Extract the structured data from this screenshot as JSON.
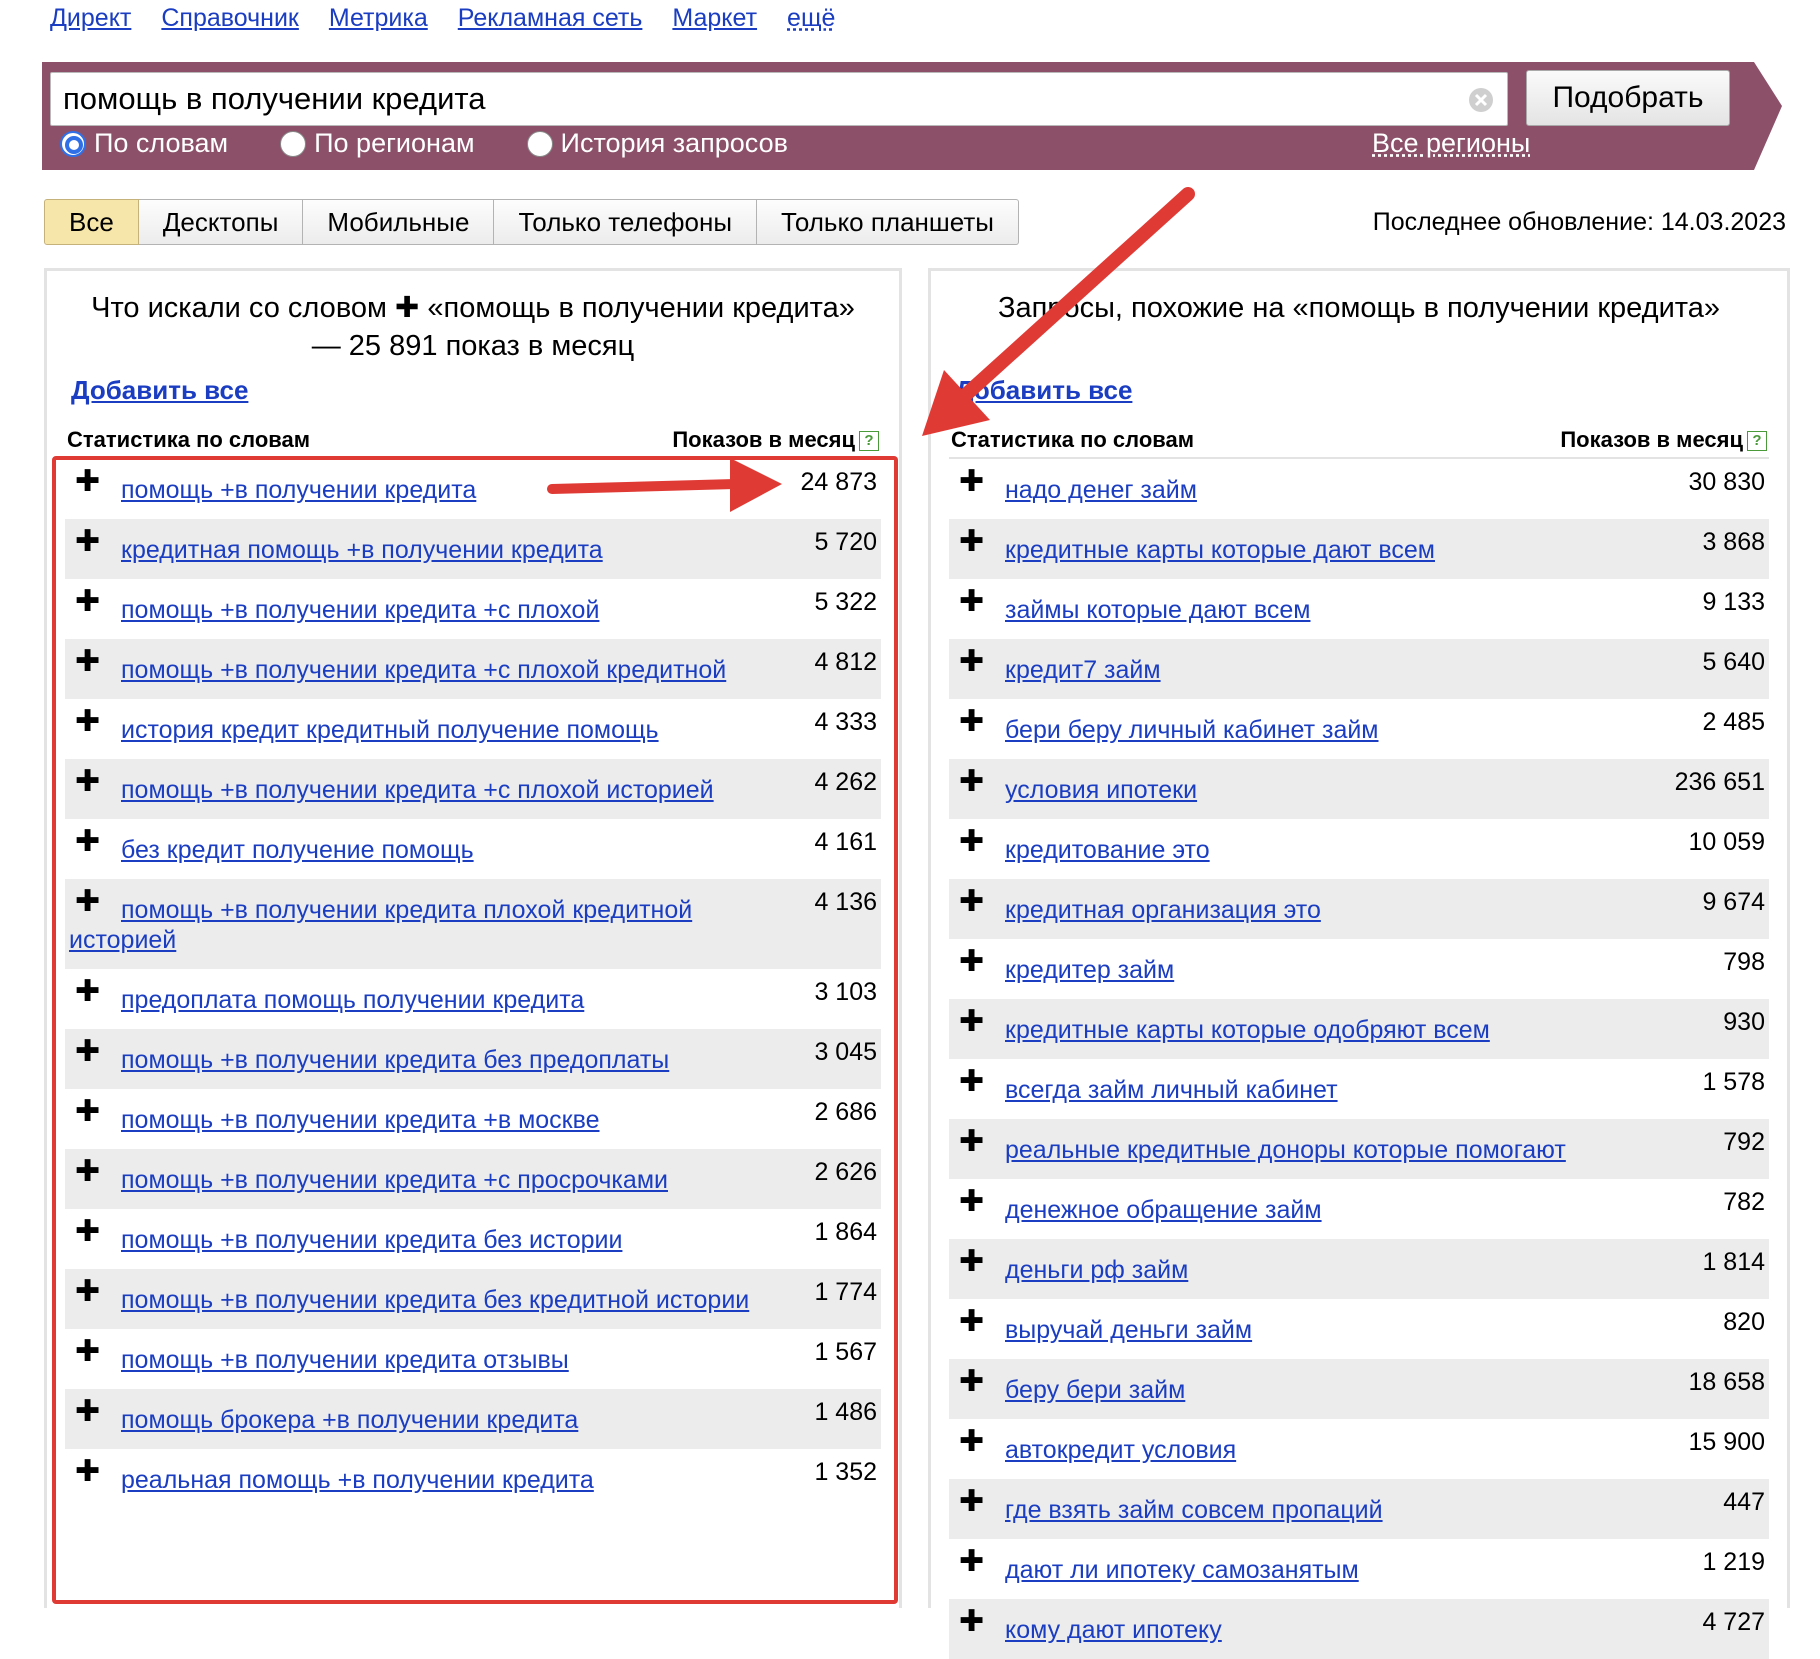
{
  "top_nav": [
    "Директ",
    "Справочник",
    "Метрика",
    "Рекламная сеть",
    "Маркет",
    "ещё"
  ],
  "search": {
    "query": "помощь в получении кредита",
    "button": "Подобрать",
    "radios": [
      "По словам",
      "По регионам",
      "История запросов"
    ],
    "selected_radio": "По словам",
    "regions": "Все регионы"
  },
  "tabs": [
    "Все",
    "Десктопы",
    "Мобильные",
    "Только телефоны",
    "Только планшеты"
  ],
  "active_tab": "Все",
  "last_update": "Последнее обновление: 14.03.2023",
  "left": {
    "title_prefix": "Что искали со словом",
    "title_rest": "«помощь в получении кредита» — 25 891 показ в месяц",
    "add_all": "Добавить все",
    "col_words": "Статистика по словам",
    "col_shows": "Показов в месяц",
    "rows": [
      {
        "phrase": "помощь +в получении кредита",
        "count": "24 873"
      },
      {
        "phrase": "кредитная помощь +в получении кредита",
        "count": "5 720"
      },
      {
        "phrase": "помощь +в получении кредита +с плохой",
        "count": "5 322"
      },
      {
        "phrase": "помощь +в получении кредита +с плохой кредитной",
        "count": "4 812"
      },
      {
        "phrase": "история кредит кредитный получение помощь",
        "count": "4 333"
      },
      {
        "phrase": "помощь +в получении кредита +с плохой историей",
        "count": "4 262"
      },
      {
        "phrase": "без кредит получение помощь",
        "count": "4 161"
      },
      {
        "phrase": "помощь +в получении кредита плохой кредитной историей",
        "count": "4 136"
      },
      {
        "phrase": "предоплата помощь получении кредита",
        "count": "3 103"
      },
      {
        "phrase": "помощь +в получении кредита без предоплаты",
        "count": "3 045"
      },
      {
        "phrase": "помощь +в получении кредита +в москве",
        "count": "2 686"
      },
      {
        "phrase": "помощь +в получении кредита +с просрочками",
        "count": "2 626"
      },
      {
        "phrase": "помощь +в получении кредита без истории",
        "count": "1 864"
      },
      {
        "phrase": "помощь +в получении кредита без кредитной истории",
        "count": "1 774"
      },
      {
        "phrase": "помощь +в получении кредита отзывы",
        "count": "1 567"
      },
      {
        "phrase": "помощь брокера +в получении кредита",
        "count": "1 486"
      },
      {
        "phrase": "реальная помощь +в получении кредита",
        "count": "1 352"
      }
    ]
  },
  "right": {
    "title": "Запросы, похожие на «помощь в получении кредита»",
    "add_all": "Добавить все",
    "col_words": "Статистика по словам",
    "col_shows": "Показов в месяц",
    "rows": [
      {
        "phrase": "надо денег займ",
        "count": "30 830"
      },
      {
        "phrase": "кредитные карты которые дают всем",
        "count": "3 868"
      },
      {
        "phrase": "займы которые дают всем",
        "count": "9 133"
      },
      {
        "phrase": "кредит7 займ",
        "count": "5 640"
      },
      {
        "phrase": "бери беру личный кабинет займ",
        "count": "2 485"
      },
      {
        "phrase": "условия ипотеки",
        "count": "236 651"
      },
      {
        "phrase": "кредитование это",
        "count": "10 059"
      },
      {
        "phrase": "кредитная организация это",
        "count": "9 674"
      },
      {
        "phrase": "кредитер займ",
        "count": "798"
      },
      {
        "phrase": "кредитные карты которые одобряют всем",
        "count": "930"
      },
      {
        "phrase": "всегда займ личный кабинет",
        "count": "1 578"
      },
      {
        "phrase": "реальные кредитные доноры которые помогают",
        "count": "792"
      },
      {
        "phrase": "денежное обращение займ",
        "count": "782"
      },
      {
        "phrase": "деньги рф займ",
        "count": "1 814"
      },
      {
        "phrase": "выручай деньги займ",
        "count": "820"
      },
      {
        "phrase": "беру бери займ",
        "count": "18 658"
      },
      {
        "phrase": "автокредит условия",
        "count": "15 900"
      },
      {
        "phrase": "где взять займ совсем пропаций",
        "count": "447"
      },
      {
        "phrase": "дают ли ипотеку самозанятым",
        "count": "1 219"
      },
      {
        "phrase": "кому дают ипотеку",
        "count": "4 727"
      }
    ]
  },
  "colors": {
    "band": "#8c5169",
    "link": "#1a3dc1",
    "annotation": "#e03a35",
    "active_tab": "#f7e6a9"
  }
}
